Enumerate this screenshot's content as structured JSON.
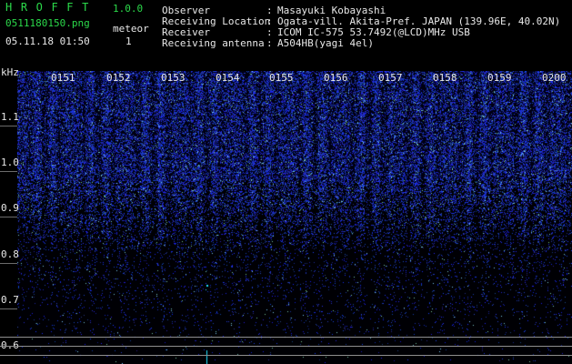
{
  "header": {
    "app_title": "HROFFT",
    "app_version": "1.0.0",
    "file_name": "0511180150.png",
    "timestamp": "05.11.18 01:50",
    "meteor_label": "meteor",
    "meteor_count": "1"
  },
  "info": [
    {
      "key": "Observer",
      "sep": ":",
      "value": "Masayuki Kobayashi"
    },
    {
      "key": "Receiving Location",
      "sep": ":",
      "value": "Ogata-vill. Akita-Pref. JAPAN (139.96E, 40.02N)"
    },
    {
      "key": "Receiver",
      "sep": ":",
      "value": "ICOM IC-575 53.7492(@LCD)MHz USB"
    },
    {
      "key": "Receiving antenna",
      "sep": ":",
      "value": "A504HB(yagi 4el)"
    }
  ],
  "spectrogram": {
    "unit": "kHz",
    "time_labels": [
      "0151",
      "0152",
      "0153",
      "0154",
      "0155",
      "0156",
      "0157",
      "0158",
      "0159",
      "0200"
    ],
    "freq_labels": [
      "1.1",
      "1.0",
      "0.9",
      "0.8",
      "0.7",
      "0.6"
    ],
    "colors": {
      "noise": "#2040e0",
      "signal": "#20e0ff",
      "grid": "#8e8e8e",
      "text_green": "#2bd94a"
    }
  }
}
